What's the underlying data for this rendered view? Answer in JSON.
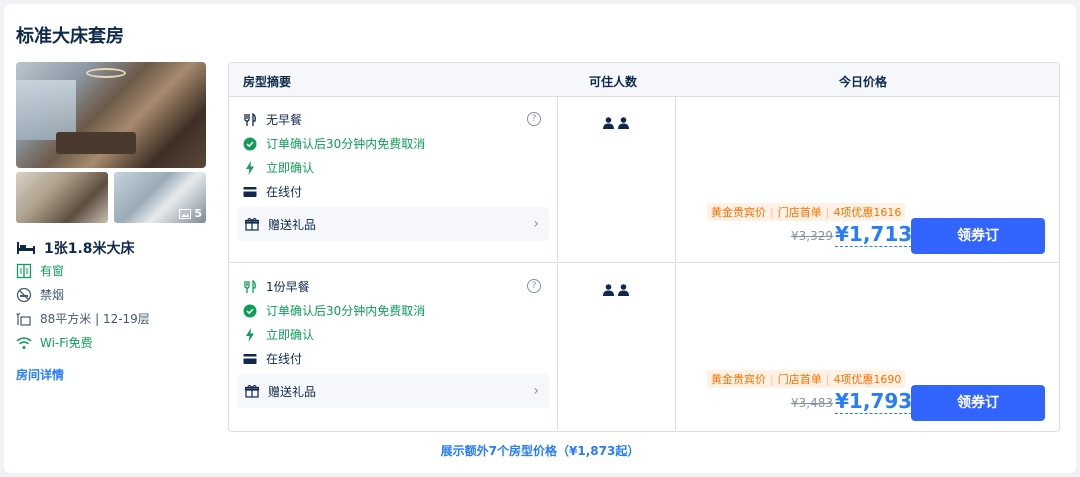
{
  "room": {
    "title": "标准大床套房",
    "photo_count": "5",
    "bed": "1张1.8米大床",
    "features": [
      {
        "icon": "window-icon",
        "label": "有窗"
      },
      {
        "icon": "no-smoking-icon",
        "label": "禁烟"
      },
      {
        "icon": "area-icon",
        "label": "88平方米 | 12-19层"
      },
      {
        "icon": "wifi-icon",
        "label": "Wi-Fi免费"
      }
    ],
    "detail_link": "房间详情"
  },
  "table": {
    "headers": [
      "房型摘要",
      "可住人数",
      "今日价格"
    ],
    "rows": [
      {
        "meal": "无早餐",
        "cancel": "订单确认后30分钟内免费取消",
        "confirm": "立即确认",
        "payment": "在线付",
        "gift": "赠送礼品",
        "tags": [
          "黄金贵宾价",
          "门店首单",
          "4项优惠1616"
        ],
        "original_price": "¥3,329",
        "price": "¥1,713",
        "book_label": "领券订"
      },
      {
        "meal": "1份早餐",
        "cancel": "订单确认后30分钟内免费取消",
        "confirm": "立即确认",
        "payment": "在线付",
        "gift": "赠送礼品",
        "tags": [
          "黄金贵宾价",
          "门店首单",
          "4项优惠1690"
        ],
        "original_price": "¥3,483",
        "price": "¥1,793",
        "book_label": "领券订"
      }
    ]
  },
  "more_link": "展示额外7个房型价格（¥1,873起）",
  "colors": {
    "accent": "#287dfa",
    "green": "#0f9d58",
    "button": "#3264ff",
    "tag_orange": "#ff6f00"
  }
}
